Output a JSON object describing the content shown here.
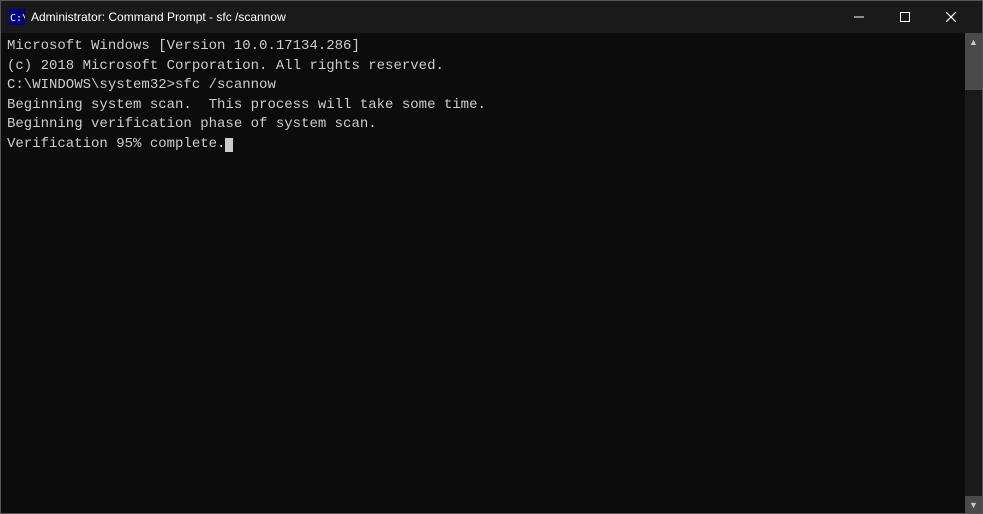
{
  "titlebar": {
    "title": "Administrator: Command Prompt - sfc /scannow",
    "minimize_label": "─",
    "maximize_label": "□",
    "close_label": "✕"
  },
  "terminal": {
    "lines": [
      "Microsoft Windows [Version 10.0.17134.286]",
      "(c) 2018 Microsoft Corporation. All rights reserved.",
      "",
      "C:\\WINDOWS\\system32>sfc /scannow",
      "",
      "Beginning system scan.  This process will take some time.",
      "",
      "Beginning verification phase of system scan.",
      "Verification 95% complete."
    ]
  }
}
